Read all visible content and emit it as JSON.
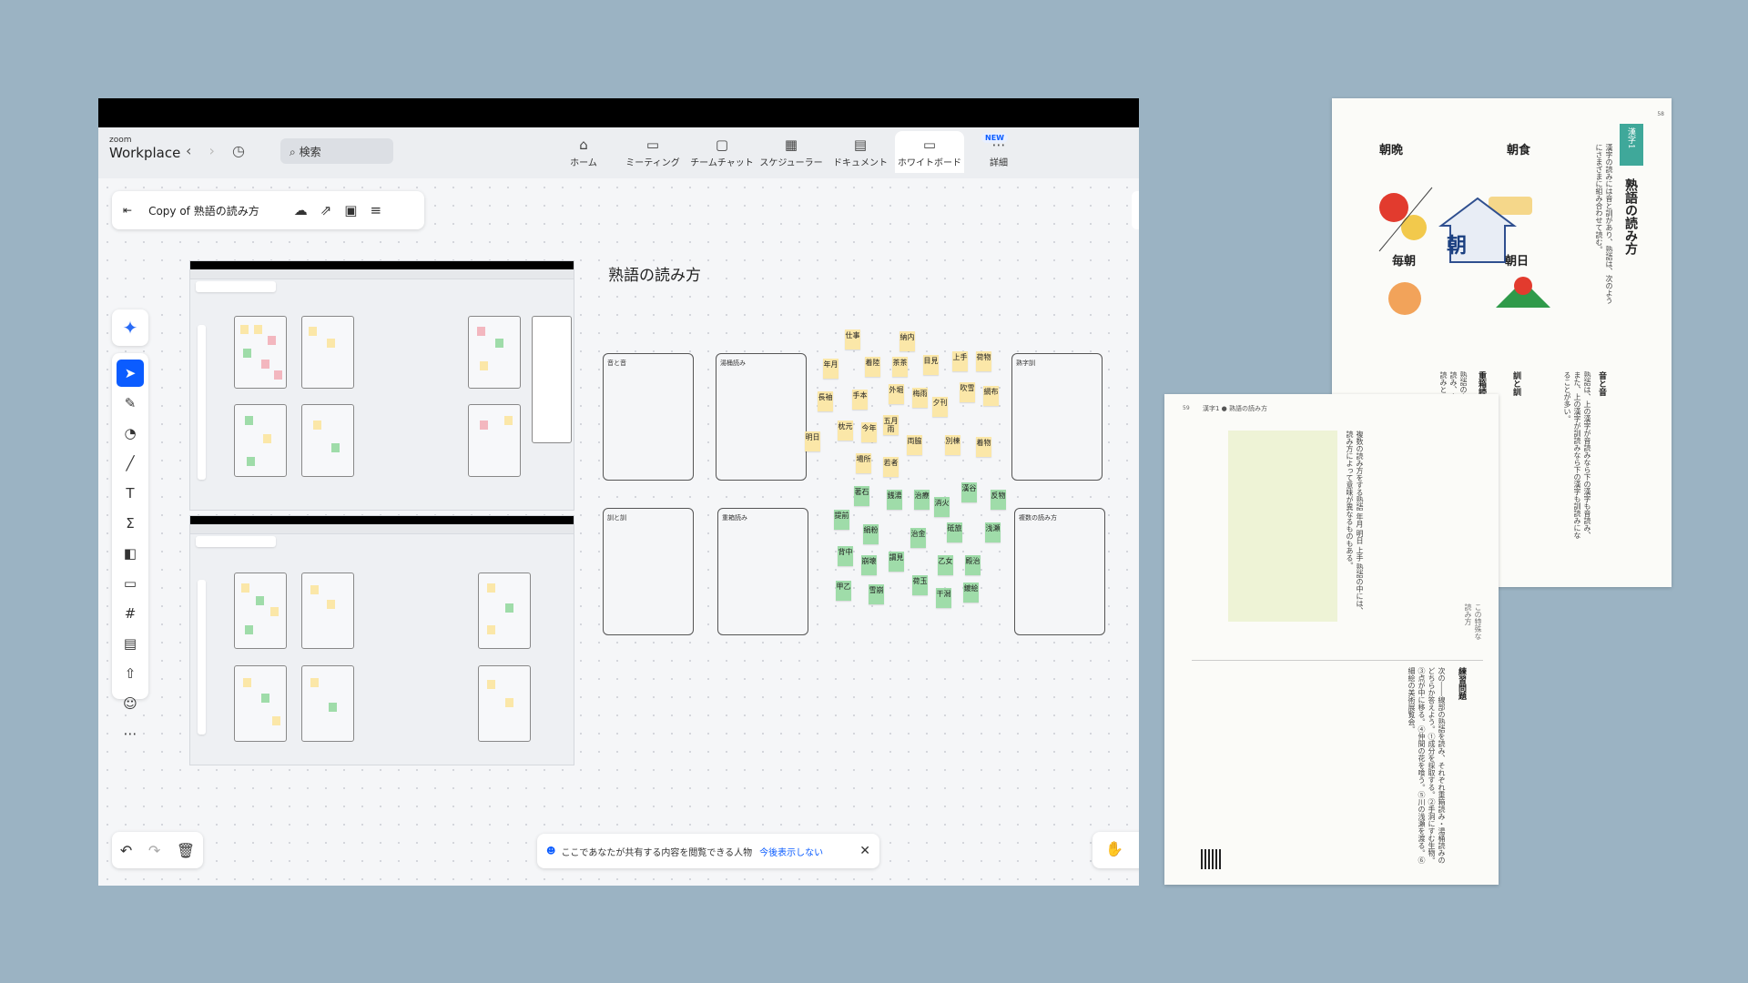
{
  "app": {
    "logo_small": "zoom",
    "logo_big": "Workplace",
    "search_placeholder": "検索",
    "tabs": [
      {
        "label": "ホーム",
        "icon": "⌂"
      },
      {
        "label": "ミーティング",
        "icon": "▭"
      },
      {
        "label": "チームチャット",
        "icon": "▢"
      },
      {
        "label": "スケジューラー",
        "icon": "▦"
      },
      {
        "label": "ドキュメント",
        "icon": "▤"
      },
      {
        "label": "ホワイトボード",
        "icon": "▭"
      },
      {
        "label": "詳細",
        "icon": "⋯"
      }
    ],
    "new_badge": "NEW"
  },
  "whiteboard": {
    "file_name": "Copy of 熟語の読み方",
    "title": "熟語の読み方",
    "share_notice": "ここであなたが共有する内容を閲覧できる人物",
    "share_link": "今後表示しない",
    "frames": [
      {
        "label": "音と音"
      },
      {
        "label": "湯桶読み"
      },
      {
        "label": "熟字訓"
      },
      {
        "label": "訓と訓"
      },
      {
        "label": "重箱読み"
      },
      {
        "label": "複数の読み方"
      }
    ],
    "yellow_notes": [
      "仕事",
      "納内",
      "年月",
      "着陸",
      "茶茶",
      "目見",
      "上手",
      "荷物",
      "長袖",
      "手本",
      "外堀",
      "梅雨",
      "夕刊",
      "吹雪",
      "網布",
      "枕元",
      "今年",
      "五月雨",
      "両脇",
      "別棟",
      "着物",
      "明日",
      "場所",
      "若者"
    ],
    "green_notes": [
      "著石",
      "銭湯",
      "治療",
      "消火",
      "漢谷",
      "反物",
      "提前",
      "絹粉",
      "治金",
      "砥旅",
      "浅瀬",
      "背中",
      "崩壊",
      "謂見",
      "乙女",
      "殿治",
      "甲乙",
      "雪崩",
      "荷玉",
      "干潟",
      "鍍絵"
    ]
  },
  "textbook": {
    "right_page": {
      "section_tag": "漢字1",
      "heading": "熟語の読み方",
      "illus_words": [
        "朝晩",
        "朝食",
        "朝",
        "毎朝",
        "朝日"
      ],
      "subheads": [
        "音と音",
        "訓と訓",
        "重箱読み・湯桶読み"
      ],
      "page_no": "58"
    },
    "left_page": {
      "header": "漢字1 ● 熟語の読み方",
      "page_no": "59",
      "exercise_heading": "練習問題"
    }
  }
}
